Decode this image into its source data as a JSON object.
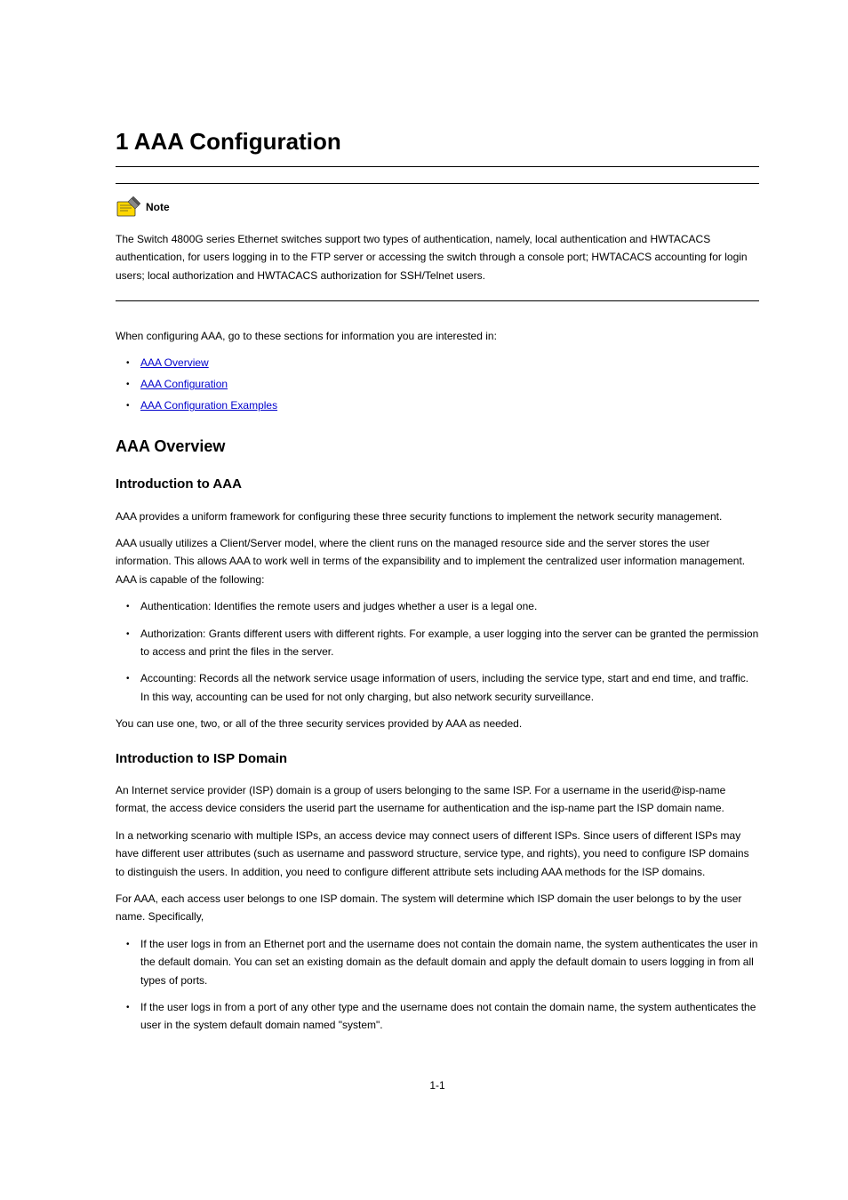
{
  "chapter_title": "1 AAA Configuration",
  "note": {
    "label": "Note",
    "text": "The Switch 4800G series Ethernet switches support two types of authentication, namely, local authentication and HWTACACS authentication, for users logging in to the FTP server or accessing the switch through a console port; HWTACACS accounting for login users; local authorization and HWTACACS authorization for SSH/Telnet users."
  },
  "intro": "When configuring AAA, go to these sections for information you are interested in:",
  "toc_links": [
    "AAA Overview",
    "AAA Configuration",
    "AAA Configuration Examples"
  ],
  "sections": {
    "aaa_overview": {
      "title": "AAA Overview",
      "intro": {
        "title": "Introduction to AAA",
        "para1": "AAA provides a uniform framework for configuring these three security functions to implement the network security management.",
        "para2": "AAA usually utilizes a Client/Server model, where the client runs on the managed resource side and the server stores the user information. This allows AAA to work well in terms of the expansibility and to implement the centralized user information management. AAA is capable of the following:",
        "bullets": [
          "Authentication: Identifies the remote users and judges whether a user is a legal one.",
          "Authorization: Grants different users with different rights. For example, a user logging into the server can be granted the permission to access and print the files in the server.",
          "Accounting: Records all the network service usage information of users, including the service type, start and end time, and traffic. In this way, accounting can be used for not only charging, but also network security surveillance."
        ],
        "para3": "You can use one, two, or all of the three security services provided by AAA as needed."
      },
      "isp": {
        "title": "Introduction to ISP Domain",
        "para1": "An Internet service provider (ISP) domain is a group of users belonging to the same ISP. For a username in the userid@isp-name format, the access device considers the userid part the username for authentication and the isp-name part the ISP domain name.",
        "para2": "In a networking scenario with multiple ISPs, an access device may connect users of different ISPs. Since users of different ISPs may have different user attributes (such as username and password structure, service type, and rights), you need to configure ISP domains to distinguish the users. In addition, you need to configure different attribute sets including AAA methods for the ISP domains.",
        "para3": "For AAA, each access user belongs to one ISP domain. The system will determine which ISP domain the user belongs to by the user name. Specifically,",
        "bullets": [
          "If the user logs in from an Ethernet port and the username does not contain the domain name, the system authenticates the user in the default domain. You can set an existing domain as the default domain and apply the default domain to users logging in from all types of ports.",
          "If the user logs in from a port of any other type and the username does not contain the domain name, the system authenticates the user in the system default domain named \"system\"."
        ]
      }
    }
  },
  "page_number": "1-1"
}
